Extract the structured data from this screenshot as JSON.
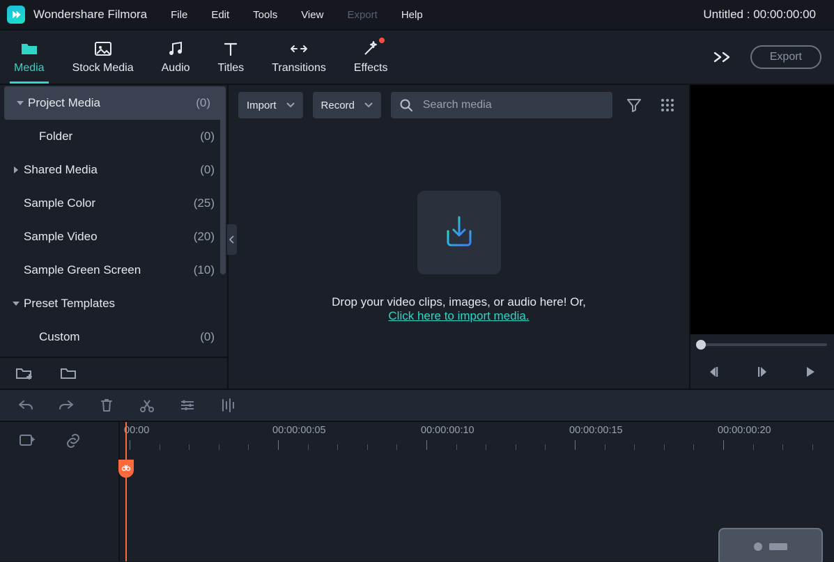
{
  "app_title": "Wondershare Filmora",
  "menu": [
    "File",
    "Edit",
    "Tools",
    "View",
    "Export",
    "Help"
  ],
  "menu_disabled_index": 4,
  "project": {
    "name": "Untitled",
    "timecode": "00:00:00:00"
  },
  "tabs": [
    {
      "id": "media",
      "label": "Media",
      "icon": "folder-icon",
      "active": true
    },
    {
      "id": "stock",
      "label": "Stock Media",
      "icon": "image-icon"
    },
    {
      "id": "audio",
      "label": "Audio",
      "icon": "music-icon"
    },
    {
      "id": "titles",
      "label": "Titles",
      "icon": "text-icon"
    },
    {
      "id": "transitions",
      "label": "Transitions",
      "icon": "transition-icon"
    },
    {
      "id": "effects",
      "label": "Effects",
      "icon": "wand-icon",
      "dot": true
    }
  ],
  "top_right": {
    "export_label": "Export"
  },
  "sidebar": {
    "items": [
      {
        "label": "Project Media",
        "count": "(0)",
        "expand": "down",
        "selected": true,
        "indent": 0
      },
      {
        "label": "Folder",
        "count": "(0)",
        "indent": 1
      },
      {
        "label": "Shared Media",
        "count": "(0)",
        "expand": "right",
        "indent": 0
      },
      {
        "label": "Sample Color",
        "count": "(25)",
        "indent": 0
      },
      {
        "label": "Sample Video",
        "count": "(20)",
        "indent": 0
      },
      {
        "label": "Sample Green Screen",
        "count": "(10)",
        "indent": 0
      },
      {
        "label": "Preset Templates",
        "count": "",
        "expand": "down",
        "indent": 0
      },
      {
        "label": "Custom",
        "count": "(0)",
        "indent": 1
      }
    ]
  },
  "media_toolbar": {
    "import_label": "Import",
    "record_label": "Record",
    "search_placeholder": "Search media"
  },
  "drop_zone": {
    "line1": "Drop your video clips, images, or audio here! Or,",
    "link": "Click here to import media."
  },
  "ruler_labels": [
    "00:00",
    "00:00:00:05",
    "00:00:00:10",
    "00:00:00:15",
    "00:00:00:20"
  ]
}
